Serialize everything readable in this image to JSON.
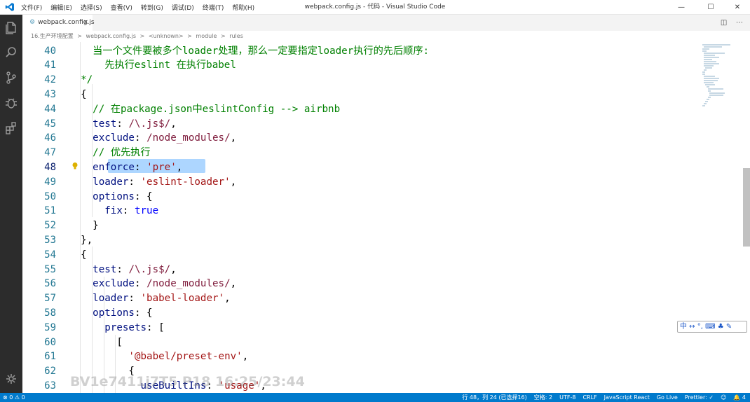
{
  "window": {
    "title": "webpack.config.js - 代码 - Visual Studio Code",
    "menu": [
      "文件(F)",
      "编辑(E)",
      "选择(S)",
      "查看(V)",
      "转到(G)",
      "调试(D)",
      "终端(T)",
      "帮助(H)"
    ]
  },
  "tab": {
    "label": "webpack.config.js",
    "close": "×"
  },
  "breadcrumb": [
    "16.生产环境配置",
    ">",
    "webpack.config.js",
    ">",
    "<unknown>",
    ">",
    "module",
    ">",
    "rules"
  ],
  "code": {
    "lines": [
      {
        "n": "40",
        "text": "    当一个文件要被多个loader处理，那么一定要指定loader执行的先后顺序:"
      },
      {
        "n": "41",
        "text": "      先执行eslint 在执行babel"
      },
      {
        "n": "42",
        "text": "  */"
      },
      {
        "n": "43",
        "text": "  {"
      },
      {
        "n": "44",
        "text": "    // 在package.json中eslintConfig --> airbnb"
      },
      {
        "n": "45",
        "text": "    test: /\\.js$/,"
      },
      {
        "n": "46",
        "text": "    exclude: /node_modules/,"
      },
      {
        "n": "47",
        "text": "    // 优先执行"
      },
      {
        "n": "48",
        "text": "    enforce: 'pre',"
      },
      {
        "n": "49",
        "text": "    loader: 'eslint-loader',"
      },
      {
        "n": "50",
        "text": "    options: {"
      },
      {
        "n": "51",
        "text": "      fix: true"
      },
      {
        "n": "52",
        "text": "    }"
      },
      {
        "n": "53",
        "text": "  },"
      },
      {
        "n": "54",
        "text": "  {"
      },
      {
        "n": "55",
        "text": "    test: /\\.js$/,"
      },
      {
        "n": "56",
        "text": "    exclude: /node_modules/,"
      },
      {
        "n": "57",
        "text": "    loader: 'babel-loader',"
      },
      {
        "n": "58",
        "text": "    options: {"
      },
      {
        "n": "59",
        "text": "      presets: ["
      },
      {
        "n": "60",
        "text": "        ["
      },
      {
        "n": "61",
        "text": "          '@babel/preset-env',"
      },
      {
        "n": "62",
        "text": "          {"
      },
      {
        "n": "63",
        "text": "            useBuiltIns: 'usage',"
      }
    ],
    "active_line": "48"
  },
  "statusbar": {
    "left": "⊗ 0 ⚠ 0",
    "right": [
      "行 48，列 24 (已选择16)",
      "空格: 2",
      "UTF-8",
      "CRLF",
      "JavaScript React",
      "Go Live",
      "Prettier: ✓",
      "☺",
      "🔔 4"
    ]
  },
  "ime": "中 ↔ °, ⌨ ♣ ✎",
  "watermark": "BV1e7411j7T5 P18 16:25/23:44",
  "colors": {
    "accent": "#007acc",
    "selection": "#add6ff",
    "activity_bar": "#2c2c2c"
  }
}
